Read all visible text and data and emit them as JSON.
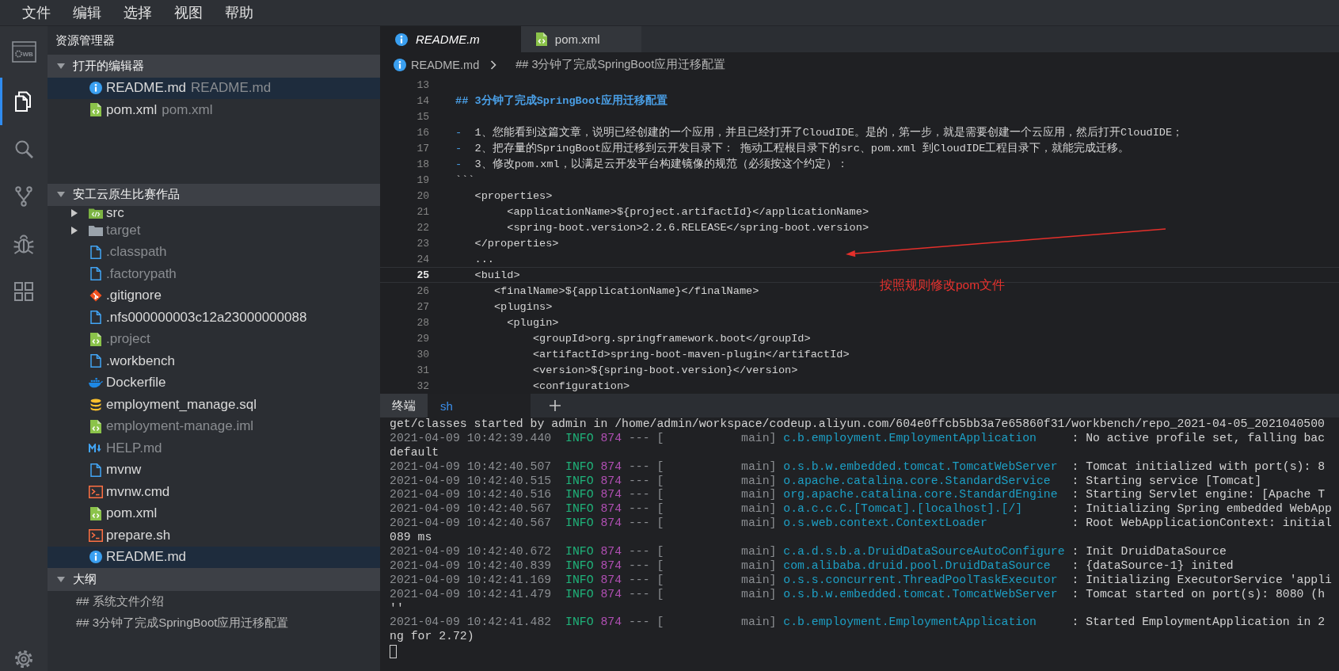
{
  "menu_bar": {
    "items": [
      "文件",
      "编辑",
      "选择",
      "视图",
      "帮助"
    ]
  },
  "activity_bar": {
    "logo_text": "WB",
    "items": [
      {
        "kind": "explorer",
        "selected": true
      },
      {
        "kind": "search",
        "selected": false
      },
      {
        "kind": "source-control",
        "selected": false
      },
      {
        "kind": "debug",
        "selected": false
      },
      {
        "kind": "extensions",
        "selected": false
      }
    ]
  },
  "sidebar": {
    "title": "资源管理器",
    "open_editors": {
      "title": "打开的编辑器",
      "expanded": true,
      "items": [
        {
          "kind": "info",
          "name": "README.md",
          "description": "README.md",
          "selected": true
        },
        {
          "kind": "xml",
          "name": "pom.xml",
          "description": "pom.xml",
          "selected": false
        }
      ]
    },
    "project": {
      "title": "安工云原生比赛作品",
      "expanded": true,
      "items": [
        {
          "kind": "code-folder",
          "name": "src",
          "expanded": false,
          "dimmed": false,
          "selected": false
        },
        {
          "kind": "folder",
          "name": "target",
          "expanded": false,
          "dimmed": true,
          "selected": false
        },
        {
          "kind": "document",
          "name": ".classpath",
          "dimmed": true,
          "selected": false
        },
        {
          "kind": "document",
          "name": ".factorypath",
          "dimmed": true,
          "selected": false
        },
        {
          "kind": "git",
          "name": ".gitignore",
          "dimmed": false,
          "selected": false
        },
        {
          "kind": "document",
          "name": ".nfs000000003c12a23000000088",
          "dimmed": false,
          "selected": false
        },
        {
          "kind": "xml",
          "name": ".project",
          "dimmed": true,
          "selected": false
        },
        {
          "kind": "document",
          "name": ".workbench",
          "dimmed": false,
          "selected": false
        },
        {
          "kind": "docker",
          "name": "Dockerfile",
          "dimmed": false,
          "selected": false
        },
        {
          "kind": "database",
          "name": "employment_manage.sql",
          "dimmed": false,
          "selected": false
        },
        {
          "kind": "xml",
          "name": "employment-manage.iml",
          "dimmed": true,
          "selected": false
        },
        {
          "kind": "markdown",
          "name": "HELP.md",
          "dimmed": true,
          "selected": false
        },
        {
          "kind": "document",
          "name": "mvnw",
          "dimmed": false,
          "selected": false
        },
        {
          "kind": "shell",
          "name": "mvnw.cmd",
          "dimmed": false,
          "selected": false
        },
        {
          "kind": "xml",
          "name": "pom.xml",
          "dimmed": false,
          "selected": false
        },
        {
          "kind": "shell",
          "name": "prepare.sh",
          "dimmed": false,
          "selected": false
        },
        {
          "kind": "info",
          "name": "README.md",
          "dimmed": false,
          "selected": true
        }
      ]
    },
    "outline": {
      "title": "大纲",
      "expanded": true,
      "items": [
        {
          "text": "## 系统文件介绍"
        },
        {
          "text": "## 3分钟了完成SpringBoot应用迁移配置"
        }
      ]
    }
  },
  "editor": {
    "tabs": [
      {
        "kind": "info",
        "label": "README.m",
        "selected": true,
        "preview": true
      },
      {
        "kind": "xml",
        "label": "pom.xml",
        "selected": false,
        "preview": false
      }
    ],
    "breadcrumb": {
      "kind": "info",
      "file": "README.md",
      "symbol": "## 3分钟了完成SpringBoot应用迁移配置"
    },
    "lines": [
      {
        "number": "13",
        "kind": "blank",
        "current": false
      },
      {
        "number": "14",
        "kind": "heading",
        "text": "## 3分钟了完成SpringBoot应用迁移配置",
        "current": false
      },
      {
        "number": "15",
        "kind": "blank",
        "current": false
      },
      {
        "number": "16",
        "kind": "list",
        "marker": "-",
        "text": "1、您能看到这篇文章，说明已经创建的一个应用，并且已经打开了CloudIDE。是的，第一步，就是需要创建一个云应用，然后打开CloudIDE；",
        "current": false
      },
      {
        "number": "17",
        "kind": "list",
        "marker": "-",
        "text": "2、把存量的SpringBoot应用迁移到云开发目录下： 拖动工程根目录下的src、pom.xml 到CloudIDE工程目录下，就能完成迁移。",
        "current": false
      },
      {
        "number": "18",
        "kind": "list",
        "marker": "-",
        "text": "3、修改pom.xml，以满足云开发平台构建镜像的规范（必须按这个约定）：",
        "current": false
      },
      {
        "number": "19",
        "kind": "code",
        "text": "```",
        "current": false
      },
      {
        "number": "20",
        "kind": "code",
        "text": "   <properties>",
        "current": false
      },
      {
        "number": "21",
        "kind": "code",
        "text": "        <applicationName>${project.artifactId}</applicationName>",
        "current": false
      },
      {
        "number": "22",
        "kind": "code",
        "text": "        <spring-boot.version>2.2.6.RELEASE</spring-boot.version>",
        "current": false
      },
      {
        "number": "23",
        "kind": "code",
        "text": "   </properties>",
        "current": false
      },
      {
        "number": "24",
        "kind": "code",
        "text": "   ...",
        "current": false
      },
      {
        "number": "25",
        "kind": "code",
        "text": "   <build>",
        "current": true
      },
      {
        "number": "26",
        "kind": "code",
        "text": "      <finalName>${applicationName}</finalName>",
        "current": false
      },
      {
        "number": "27",
        "kind": "code",
        "text": "      <plugins>",
        "current": false
      },
      {
        "number": "28",
        "kind": "code",
        "text": "        <plugin>",
        "current": false
      },
      {
        "number": "29",
        "kind": "code",
        "text": "            <groupId>org.springframework.boot</groupId>",
        "current": false
      },
      {
        "number": "30",
        "kind": "code",
        "text": "            <artifactId>spring-boot-maven-plugin</artifactId>",
        "current": false
      },
      {
        "number": "31",
        "kind": "code",
        "text": "            <version>${spring-boot.version}</version>",
        "current": false
      },
      {
        "number": "32",
        "kind": "code",
        "text": "            <configuration>",
        "current": false
      }
    ],
    "annotation": {
      "text": "按照规则修改pom文件"
    }
  },
  "terminal": {
    "title": "终端",
    "tabs": [
      {
        "label": "sh",
        "selected": true
      }
    ],
    "lines": [
      {
        "kind": "text",
        "text": "get/classes started by admin in /home/admin/workspace/codeup.aliyun.com/604e0ffcb5bb3a7e65860f31/workbench/repo_2021-04-05_2021040500"
      },
      {
        "kind": "log",
        "time": "2021-04-09 10:42:39.440",
        "severity": "INFO",
        "pid": "874",
        "separator": "---",
        "thread": "[           main]",
        "logger": "c.b.employment.EmploymentApplication",
        "message": ": No active profile set, falling bac"
      },
      {
        "kind": "text",
        "text": "default"
      },
      {
        "kind": "log",
        "time": "2021-04-09 10:42:40.507",
        "severity": "INFO",
        "pid": "874",
        "separator": "---",
        "thread": "[           main]",
        "logger": "o.s.b.w.embedded.tomcat.TomcatWebServer",
        "message": ": Tomcat initialized with port(s): 8"
      },
      {
        "kind": "log",
        "time": "2021-04-09 10:42:40.515",
        "severity": "INFO",
        "pid": "874",
        "separator": "---",
        "thread": "[           main]",
        "logger": "o.apache.catalina.core.StandardService",
        "message": ": Starting service [Tomcat]"
      },
      {
        "kind": "log",
        "time": "2021-04-09 10:42:40.516",
        "severity": "INFO",
        "pid": "874",
        "separator": "---",
        "thread": "[           main]",
        "logger": "org.apache.catalina.core.StandardEngine",
        "message": ": Starting Servlet engine: [Apache T"
      },
      {
        "kind": "log",
        "time": "2021-04-09 10:42:40.567",
        "severity": "INFO",
        "pid": "874",
        "separator": "---",
        "thread": "[           main]",
        "logger": "o.a.c.c.C.[Tomcat].[localhost].[/]",
        "message": ": Initializing Spring embedded WebApp"
      },
      {
        "kind": "log",
        "time": "2021-04-09 10:42:40.567",
        "severity": "INFO",
        "pid": "874",
        "separator": "---",
        "thread": "[           main]",
        "logger": "o.s.web.context.ContextLoader",
        "message": ": Root WebApplicationContext: initial"
      },
      {
        "kind": "text",
        "text": "089 ms"
      },
      {
        "kind": "log",
        "time": "2021-04-09 10:42:40.672",
        "severity": "INFO",
        "pid": "874",
        "separator": "---",
        "thread": "[           main]",
        "logger": "c.a.d.s.b.a.DruidDataSourceAutoConfigure",
        "message": ": Init DruidDataSource"
      },
      {
        "kind": "log",
        "time": "2021-04-09 10:42:40.839",
        "severity": "INFO",
        "pid": "874",
        "separator": "---",
        "thread": "[           main]",
        "logger": "com.alibaba.druid.pool.DruidDataSource",
        "message": ": {dataSource-1} inited"
      },
      {
        "kind": "log",
        "time": "2021-04-09 10:42:41.169",
        "severity": "INFO",
        "pid": "874",
        "separator": "---",
        "thread": "[           main]",
        "logger": "o.s.s.concurrent.ThreadPoolTaskExecutor",
        "message": ": Initializing ExecutorService 'appli"
      },
      {
        "kind": "log",
        "time": "2021-04-09 10:42:41.479",
        "severity": "INFO",
        "pid": "874",
        "separator": "---",
        "thread": "[           main]",
        "logger": "o.s.b.w.embedded.tomcat.TomcatWebServer",
        "message": ": Tomcat started on port(s): 8080 (h"
      },
      {
        "kind": "text",
        "text": "''"
      },
      {
        "kind": "log",
        "time": "2021-04-09 10:42:41.482",
        "severity": "INFO",
        "pid": "874",
        "separator": "---",
        "thread": "[           main]",
        "logger": "c.b.employment.EmploymentApplication",
        "message": ": Started EmploymentApplication in 2"
      },
      {
        "kind": "text",
        "text": "ng for 2.72)"
      }
    ]
  }
}
